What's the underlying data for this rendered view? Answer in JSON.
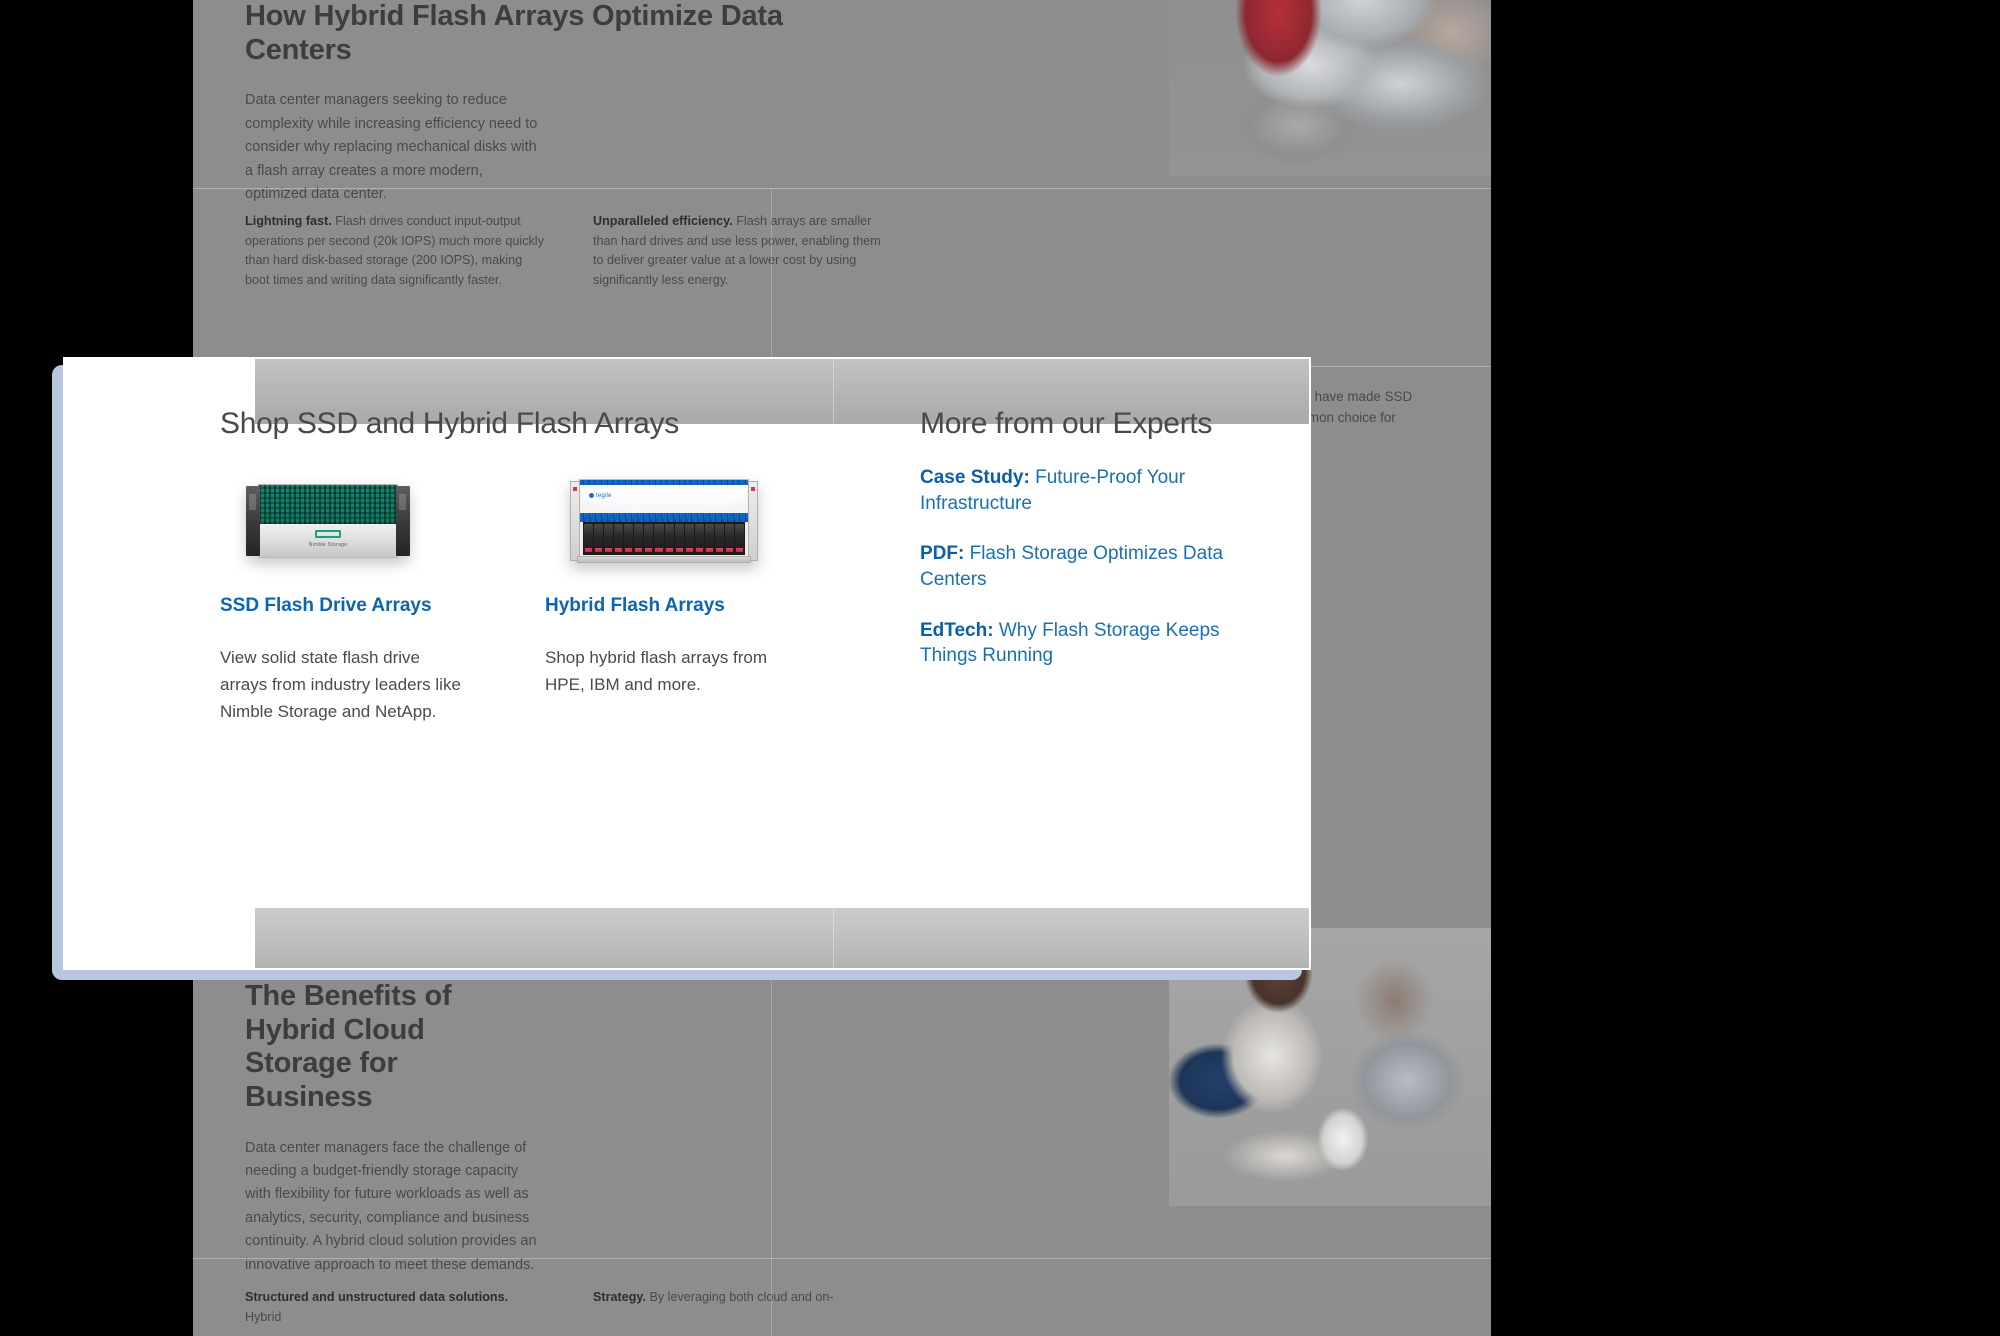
{
  "modal": {
    "left_column": {
      "heading": "Shop SSD and Hybrid Flash Arrays",
      "products": [
        {
          "image_name": "nimble-storage-ssd-flash-array-image",
          "title": "SSD Flash Drive Arrays",
          "description": "View solid state flash drive arrays from industry leaders like Nimble Storage and NetApp.",
          "device_brand": "Nimble Storage"
        },
        {
          "image_name": "tegile-hybrid-flash-array-image",
          "title": "Hybrid Flash Arrays",
          "description": "Shop hybrid flash arrays from HPE, IBM and more.",
          "device_brand": "tegile"
        }
      ]
    },
    "right_column": {
      "heading": "More from our Experts",
      "links": [
        {
          "tag": "Case Study:",
          "text": "Future-Proof Your Infrastructure"
        },
        {
          "tag": "PDF:",
          "text": "Flash Storage Optimizes Data Centers"
        },
        {
          "tag": "EdTech:",
          "text": "Why Flash Storage Keeps Things Running"
        }
      ]
    }
  },
  "background": {
    "article_top": {
      "title": "How Hybrid Flash Arrays Optimize Data Centers",
      "lede": "Data center managers seeking to reduce complexity while increasing efficiency need to consider why replacing mechanical disks with a flash array creates a more modern, optimized data center.",
      "photo_name": "people-with-laptops-photo",
      "columns": [
        {
          "lead": "Lightning fast.",
          "body": " Flash drives conduct input-output operations per second (20k IOPS) much more quickly than hard disk-based storage (200 IOPS), making boot times and writing data significantly faster."
        },
        {
          "lead": "Unparalleled efficiency.",
          "body": " Flash arrays are smaller than hard drives and use less power, enabling them to deliver greater value at a lower cost by using significantly less energy."
        }
      ],
      "partial_text_left": "r prices have made SSD",
      "partial_text_left2": "re common choice for"
    },
    "experts_behind": {
      "heading": "More from our Experts",
      "links": [
        {
          "tag": ":",
          "text": " Future-Proof Your"
        },
        {
          "tag": "",
          "text": "re"
        },
        {
          "tag": "",
          "text": "Storage Optimizes Data"
        },
        {
          "tag": "",
          "text": "y Flash Storage Keeps"
        },
        {
          "tag": "",
          "text": "ning"
        }
      ]
    },
    "article_bottom": {
      "title": "The Benefits of Hybrid Cloud Storage for Business",
      "lede": "Data center managers face the challenge of needing a budget-friendly storage capacity with flexibility for future workloads as well as analytics, security, compliance and business continuity. A hybrid cloud solution provides an innovative approach to meet these demands.",
      "photo_name": "two-colleagues-at-desk-photo",
      "columns": [
        {
          "lead": "Structured and unstructured data solutions.",
          "body": " Hybrid"
        },
        {
          "lead": "Strategy.",
          "body": " By leveraging both cloud and on-"
        }
      ]
    }
  },
  "colors": {
    "link_blue": "#1a6fb5",
    "link_blue_bold": "#0b5ea8",
    "heading_gray": "#494949",
    "body_gray": "#4b4b4b",
    "modal_shadow": "#b8c6e0",
    "page_dim": "#8d8d8d"
  }
}
